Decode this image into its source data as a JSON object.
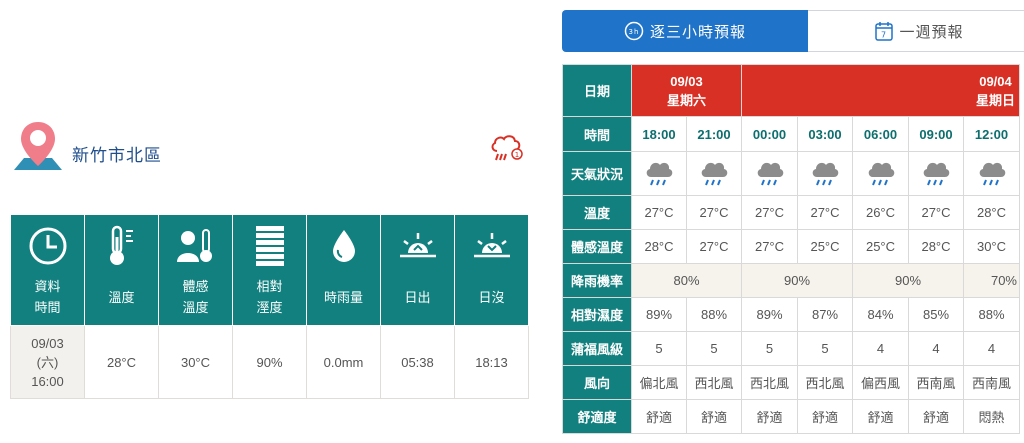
{
  "location": {
    "name": "新竹市北區",
    "pin_icon": "map-pin-icon",
    "alert_icon": "heavy-rain-alert-icon"
  },
  "current": {
    "headers": [
      {
        "key": "time",
        "label_line1": "資料",
        "label_line2": "時間",
        "icon": "clock-icon"
      },
      {
        "key": "temp",
        "label_line1": "溫度",
        "label_line2": "",
        "icon": "thermometer-icon"
      },
      {
        "key": "feel",
        "label_line1": "體感",
        "label_line2": "溫度",
        "icon": "person-thermometer-icon"
      },
      {
        "key": "hum",
        "label_line1": "相對",
        "label_line2": "溼度",
        "icon": "humidity-bars-icon"
      },
      {
        "key": "rain",
        "label_line1": "時雨量",
        "label_line2": "",
        "icon": "raindrop-icon"
      },
      {
        "key": "sunrise",
        "label_line1": "日出",
        "label_line2": "",
        "icon": "sunrise-icon"
      },
      {
        "key": "sunset",
        "label_line1": "日沒",
        "label_line2": "",
        "icon": "sunset-icon"
      }
    ],
    "values": {
      "time_line1": "09/03",
      "time_line2": "(六)",
      "time_line3": "16:00",
      "temp": "28°C",
      "feel": "30°C",
      "hum": "90%",
      "rain": "0.0mm",
      "sunrise": "05:38",
      "sunset": "18:13"
    }
  },
  "tabs": [
    {
      "label": "逐三小時預報",
      "icon": "3h-clock-icon",
      "active": true
    },
    {
      "label": "一週預報",
      "icon": "calendar-7-icon",
      "active": false
    }
  ],
  "forecast": {
    "row_labels": {
      "date": "日期",
      "time": "時間",
      "weather": "天氣狀況",
      "temp": "溫度",
      "feel": "體感溫度",
      "rain": "降雨機率",
      "hum": "相對濕度",
      "wind_scale": "蒲福風級",
      "wind_dir": "風向",
      "comfort": "舒適度"
    },
    "dates": [
      {
        "date": "09/03",
        "weekday": "星期六"
      },
      {
        "date": "09/04",
        "weekday": "星期日"
      }
    ],
    "times": [
      "18:00",
      "21:00",
      "00:00",
      "03:00",
      "06:00",
      "09:00",
      "12:00"
    ],
    "weather_icons": [
      "rain-cloud-icon",
      "rain-cloud-icon",
      "rain-cloud-icon",
      "rain-cloud-icon",
      "rain-cloud-icon",
      "rain-cloud-icon",
      "rain-cloud-icon"
    ],
    "temp": [
      "27°C",
      "27°C",
      "27°C",
      "27°C",
      "26°C",
      "27°C",
      "28°C"
    ],
    "feel": [
      "28°C",
      "27°C",
      "27°C",
      "25°C",
      "25°C",
      "28°C",
      "30°C"
    ],
    "rain": [
      "80%",
      "90%",
      "90%",
      "70%"
    ],
    "hum": [
      "89%",
      "88%",
      "89%",
      "87%",
      "84%",
      "85%",
      "88%"
    ],
    "wind_scale": [
      "5",
      "5",
      "5",
      "5",
      "4",
      "4",
      "4"
    ],
    "wind_dir": [
      "偏北風",
      "西北風",
      "西北風",
      "西北風",
      "偏西風",
      "西南風",
      "西南風"
    ],
    "comfort": [
      "舒適",
      "舒適",
      "舒適",
      "舒適",
      "舒適",
      "舒適",
      "悶熱"
    ]
  },
  "colors": {
    "teal": "#11807f",
    "red": "#d93025",
    "blue": "#1f73c8",
    "beige": "#f6f3ec"
  }
}
